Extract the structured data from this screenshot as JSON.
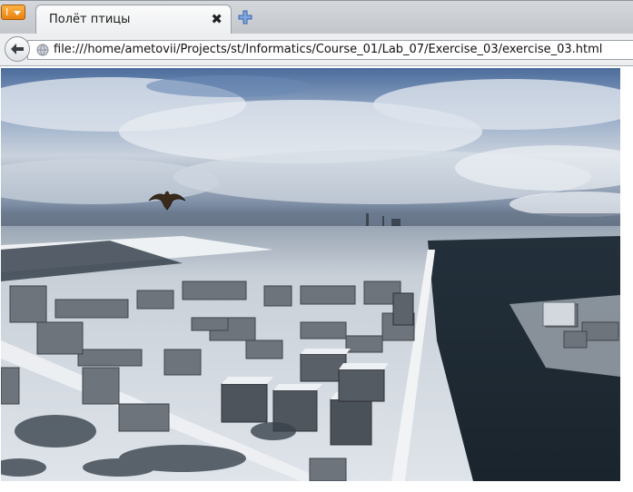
{
  "browser": {
    "app_menu_glyph": "I",
    "tab": {
      "title": "Полёт птицы",
      "close_glyph": "✖"
    },
    "url": "file:///home/ametovii/Projects/st/Informatics/Course_01/Lab_07/Exercise_03/exercise_03.html"
  },
  "page": {
    "image": "aerial-winter-city-photo",
    "sprite": "bird-icon"
  },
  "colors": {
    "accent_orange": "#f08a14",
    "sky_top": "#4d6f9f",
    "snow": "#dfe5ec"
  }
}
